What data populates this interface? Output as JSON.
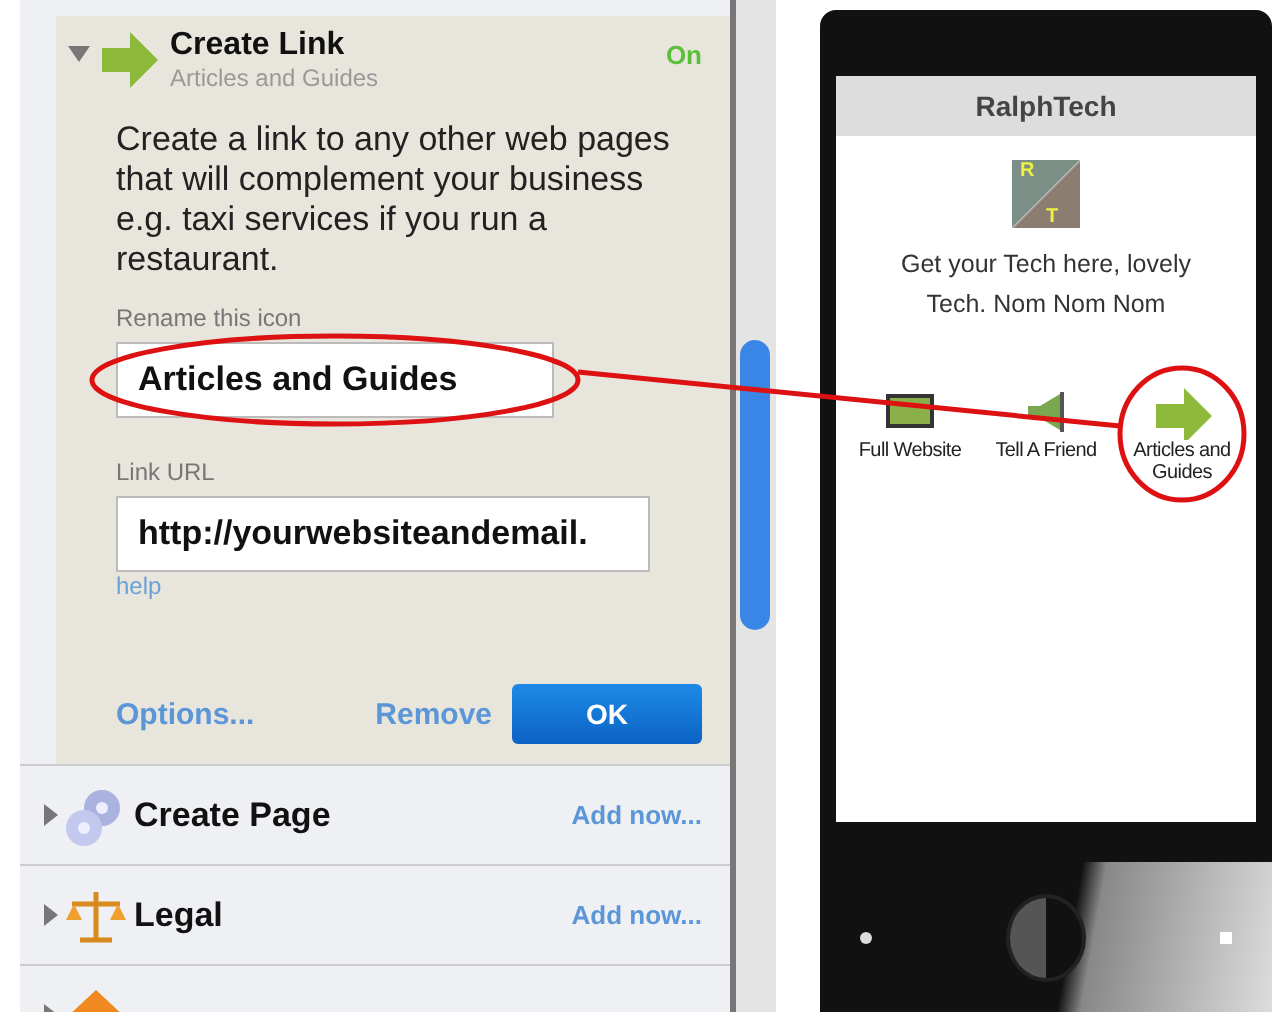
{
  "panel": {
    "expanded_item": {
      "title": "Create Link",
      "subtitle": "Articles and Guides",
      "status": "On",
      "expanded": true,
      "kind": "arrow",
      "description": "Create a link to any other web pages that will complement your business e.g. taxi services if you run a restaurant.",
      "fields": [
        {
          "label": "Rename this icon",
          "value": "Articles and Guides"
        },
        {
          "label": "Link URL",
          "value": "http://yourwebsiteandemail."
        }
      ],
      "help": "help",
      "options": "Options...",
      "remove": "Remove",
      "ok": "OK"
    },
    "items": [
      {
        "title": "Create Page",
        "action": "Add now...",
        "kind": "gears",
        "expanded": false
      },
      {
        "title": "Legal",
        "action": "Add now...",
        "kind": "scales",
        "expanded": false
      },
      {
        "kind": "house",
        "expanded": false
      }
    ]
  },
  "phone": {
    "title": "RalphTech",
    "logo": {
      "letter_top": "R",
      "letter_bottom": "T"
    },
    "tagline": "Get your Tech here, lovely Tech. Nom Nom Nom",
    "icons": [
      {
        "label": "Full Website",
        "kind": "monitor"
      },
      {
        "label": "Tell A Friend",
        "kind": "megaphone"
      },
      {
        "label": "Articles and Guides",
        "kind": "arrow"
      }
    ]
  }
}
